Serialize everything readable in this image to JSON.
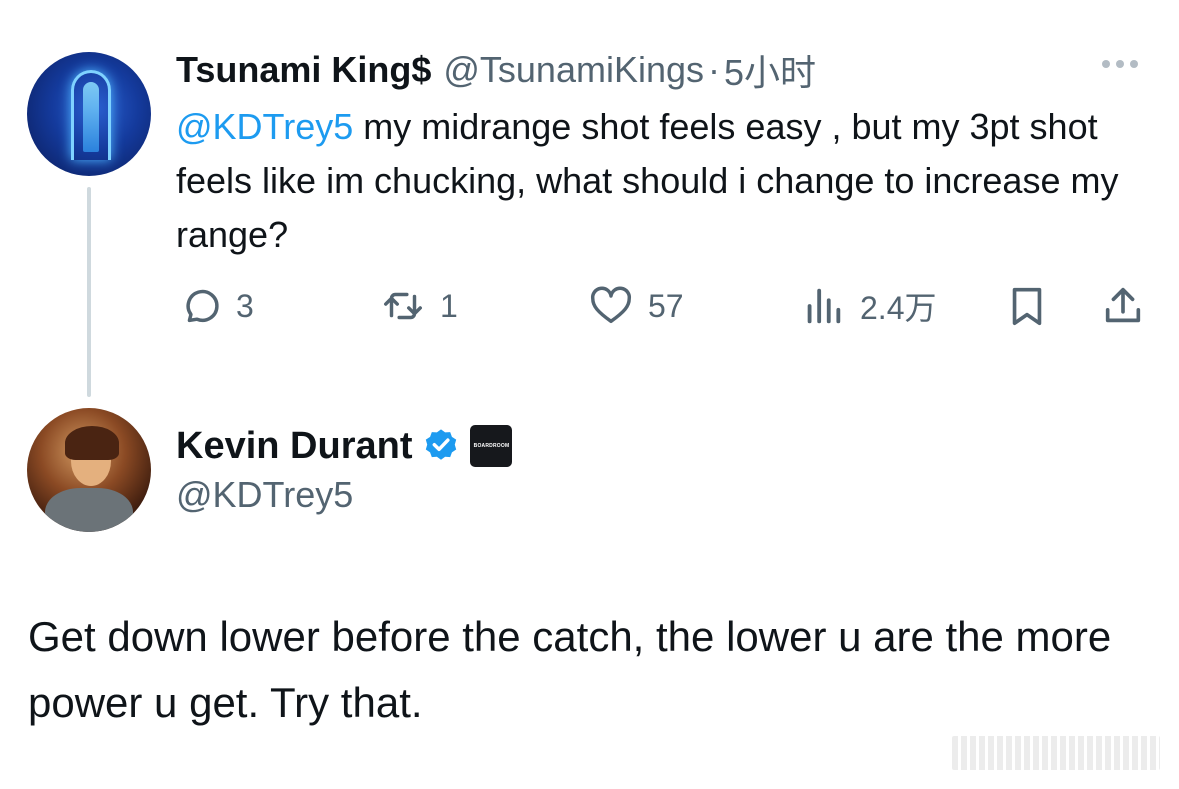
{
  "reply_to_tweet": {
    "author_name": "Tsunami King$",
    "author_handle": "@TsunamiKings",
    "separator": "·",
    "time": "5小时",
    "mention": "@KDTrey5",
    "text": " my midrange shot feels easy , but my 3pt shot feels like im chucking, what should i change to increase my range?",
    "stats": {
      "replies": "3",
      "retweets": "1",
      "likes": "57",
      "views": "2.4万"
    }
  },
  "reply_tweet": {
    "author_name": "Kevin Durant",
    "author_handle": "@KDTrey5",
    "affiliate_label": "BOARDROOM",
    "text": "Get down lower before the catch, the lower u are the more power u get. Try that."
  },
  "icons": {
    "more": "more-dots-icon",
    "reply": "reply-bubble-icon",
    "retweet": "retweet-icon",
    "like": "heart-icon",
    "views": "views-chart-icon",
    "bookmark": "bookmark-icon",
    "share": "share-icon",
    "verified": "verified-badge-icon"
  },
  "colors": {
    "text_primary": "#0f1419",
    "text_secondary": "#536471",
    "link": "#1d9bf0",
    "thread_line": "#cfd9de",
    "affiliate_bg": "#16181c"
  }
}
